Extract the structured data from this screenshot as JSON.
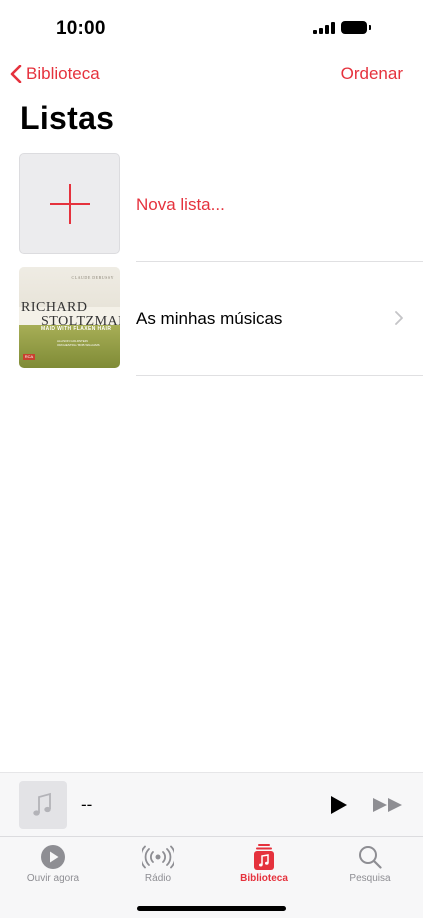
{
  "status_bar": {
    "time": "10:00"
  },
  "nav": {
    "back_label": "Biblioteca",
    "sort_label": "Ordenar"
  },
  "title": "Listas",
  "rows": [
    {
      "label": "Nova lista..."
    },
    {
      "label": "As minhas músicas",
      "cover": {
        "top_text": "CLAUDE DEBUSSY",
        "name_line1": "RICHARD",
        "name_line2": "STOLTZMAN",
        "subtitle": "MAID WITH FLAXEN HAIR",
        "small_text": "ALLISON GOLDSTEIN ORCHESTRA / BOB WILLIAMS",
        "logo": "RCA"
      }
    }
  ],
  "mini_player": {
    "title": "--"
  },
  "tabs": [
    {
      "label": "Ouvir agora",
      "icon": "play-circle-icon"
    },
    {
      "label": "Rádio",
      "icon": "radio-icon"
    },
    {
      "label": "Biblioteca",
      "icon": "library-icon",
      "active": true
    },
    {
      "label": "Pesquisa",
      "icon": "search-icon"
    }
  ],
  "colors": {
    "accent": "#e5323d",
    "tab_inactive": "#8e8e93"
  }
}
